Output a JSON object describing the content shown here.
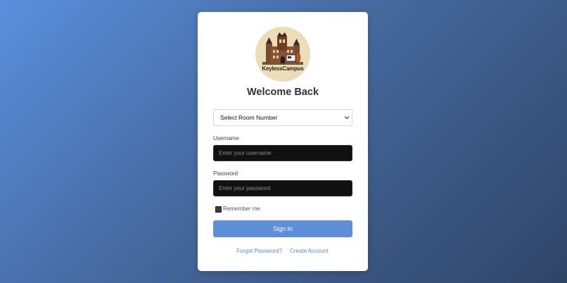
{
  "logo": {
    "text": "KeylessCampus",
    "icon": "castle-icon"
  },
  "title": "Welcome Back",
  "room_select": {
    "selected": "Select Room Number"
  },
  "username": {
    "label": "Username",
    "placeholder": "Enter your username"
  },
  "password": {
    "label": "Password",
    "placeholder": "Enter your password"
  },
  "remember": {
    "label": "Remember me",
    "checked": false
  },
  "sign_in": {
    "label": "Sign In"
  },
  "links": {
    "forgot": "Forgot Password?",
    "create": "Create Account"
  },
  "colors": {
    "accent": "#5e8ed8",
    "link": "#5b8dd6",
    "input_bg": "#111111",
    "logo_bg": "#ecdcb8"
  }
}
